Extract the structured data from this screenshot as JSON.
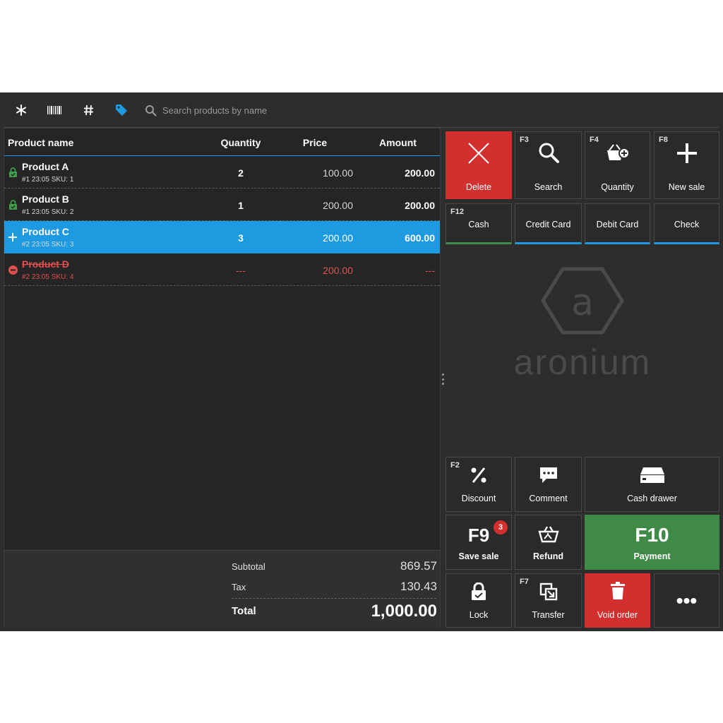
{
  "toolbar": {
    "icons": [
      "asterisk-icon",
      "barcode-icon",
      "hash-icon",
      "tag-icon",
      "search-icon"
    ],
    "search_placeholder": "Search products by name"
  },
  "grid": {
    "columns": [
      "Product name",
      "Quantity",
      "Price",
      "Amount"
    ],
    "rows": [
      {
        "name": "Product A",
        "sub": "#1 23:05 SKU: 1",
        "quantity": "2",
        "price": "100.00",
        "amount": "200.00",
        "status": "locked"
      },
      {
        "name": "Product B",
        "sub": "#1 23:05 SKU: 2",
        "quantity": "1",
        "price": "200.00",
        "amount": "200.00",
        "status": "locked"
      },
      {
        "name": "Product C",
        "sub": "#2 23:05 SKU: 3",
        "quantity": "3",
        "price": "200.00",
        "amount": "600.00",
        "status": "selected-added"
      },
      {
        "name": "Product D",
        "sub": "#2 23:05 SKU: 4",
        "quantity": "---",
        "price": "200.00",
        "amount": "---",
        "status": "voided"
      }
    ]
  },
  "totals": {
    "subtotal_label": "Subtotal",
    "subtotal": "869.57",
    "tax_label": "Tax",
    "tax": "130.43",
    "total_label": "Total",
    "total": "1,000.00"
  },
  "buttons": {
    "delete": {
      "label": "Delete"
    },
    "search": {
      "key": "F3",
      "label": "Search"
    },
    "quantity": {
      "key": "F4",
      "label": "Quantity"
    },
    "new_sale": {
      "key": "F8",
      "label": "New sale"
    },
    "cash": {
      "key": "F12",
      "label": "Cash"
    },
    "credit_card": {
      "label": "Credit Card"
    },
    "debit_card": {
      "label": "Debit Card"
    },
    "check": {
      "label": "Check"
    },
    "discount": {
      "key": "F2",
      "label": "Discount"
    },
    "comment": {
      "label": "Comment"
    },
    "cash_drawer": {
      "label": "Cash drawer"
    },
    "save_sale": {
      "key": "F9",
      "label": "Save sale",
      "badge": "3"
    },
    "refund": {
      "label": "Refund"
    },
    "payment": {
      "key": "F10",
      "label": "Payment"
    },
    "lock": {
      "label": "Lock"
    },
    "transfer": {
      "key": "F7",
      "label": "Transfer"
    },
    "void_order": {
      "label": "Void order"
    },
    "more": {
      "label": "•••"
    }
  },
  "logo": {
    "text": "aronium",
    "letter": "a"
  },
  "colors": {
    "accent": "#1e9be0",
    "danger": "#d32f2f",
    "success": "#3f8a47",
    "background": "#2d2d2d"
  }
}
